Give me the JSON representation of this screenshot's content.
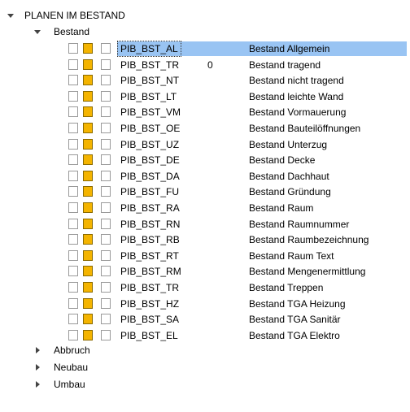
{
  "root": {
    "label": "PLANEN IM BESTAND",
    "expanded": true
  },
  "groups": [
    {
      "label": "Bestand",
      "expanded": true
    },
    {
      "label": "Abbruch",
      "expanded": false
    },
    {
      "label": "Neubau",
      "expanded": false
    },
    {
      "label": "Umbau",
      "expanded": false
    }
  ],
  "layers": [
    {
      "code": "PIB_BST_AL",
      "num": "",
      "desc": "Bestand Allgemein",
      "selected": true
    },
    {
      "code": "PIB_BST_TR",
      "num": "0",
      "desc": "Bestand tragend"
    },
    {
      "code": "PIB_BST_NT",
      "num": "",
      "desc": "Bestand nicht tragend"
    },
    {
      "code": "PIB_BST_LT",
      "num": "",
      "desc": "Bestand leichte Wand"
    },
    {
      "code": "PIB_BST_VM",
      "num": "",
      "desc": "Bestand Vormauerung"
    },
    {
      "code": "PIB_BST_OE",
      "num": "",
      "desc": "Bestand Bauteilöffnungen"
    },
    {
      "code": "PIB_BST_UZ",
      "num": "",
      "desc": "Bestand Unterzug"
    },
    {
      "code": "PIB_BST_DE",
      "num": "",
      "desc": "Bestand Decke"
    },
    {
      "code": "PIB_BST_DA",
      "num": "",
      "desc": "Bestand Dachhaut"
    },
    {
      "code": "PIB_BST_FU",
      "num": "",
      "desc": "Bestand Gründung"
    },
    {
      "code": "PIB_BST_RA",
      "num": "",
      "desc": "Bestand Raum"
    },
    {
      "code": "PIB_BST_RN",
      "num": "",
      "desc": "Bestand Raumnummer"
    },
    {
      "code": "PIB_BST_RB",
      "num": "",
      "desc": "Bestand Raumbezeichnung"
    },
    {
      "code": "PIB_BST_RT",
      "num": "",
      "desc": "Bestand Raum Text"
    },
    {
      "code": "PIB_BST_RM",
      "num": "",
      "desc": "Bestand Mengenermittlung"
    },
    {
      "code": "PIB_BST_TR",
      "num": "",
      "desc": "Bestand Treppen"
    },
    {
      "code": "PIB_BST_HZ",
      "num": "",
      "desc": "Bestand TGA Heizung"
    },
    {
      "code": "PIB_BST_SA",
      "num": "",
      "desc": "Bestand TGA Sanitär"
    },
    {
      "code": "PIB_BST_EL",
      "num": "",
      "desc": "Bestand TGA Elektro"
    }
  ],
  "colors": {
    "selection": "#99c4f3",
    "layer_color": "#f4b400"
  },
  "icons": {
    "expanded": "triangle-down-icon",
    "collapsed": "triangle-right-icon"
  }
}
